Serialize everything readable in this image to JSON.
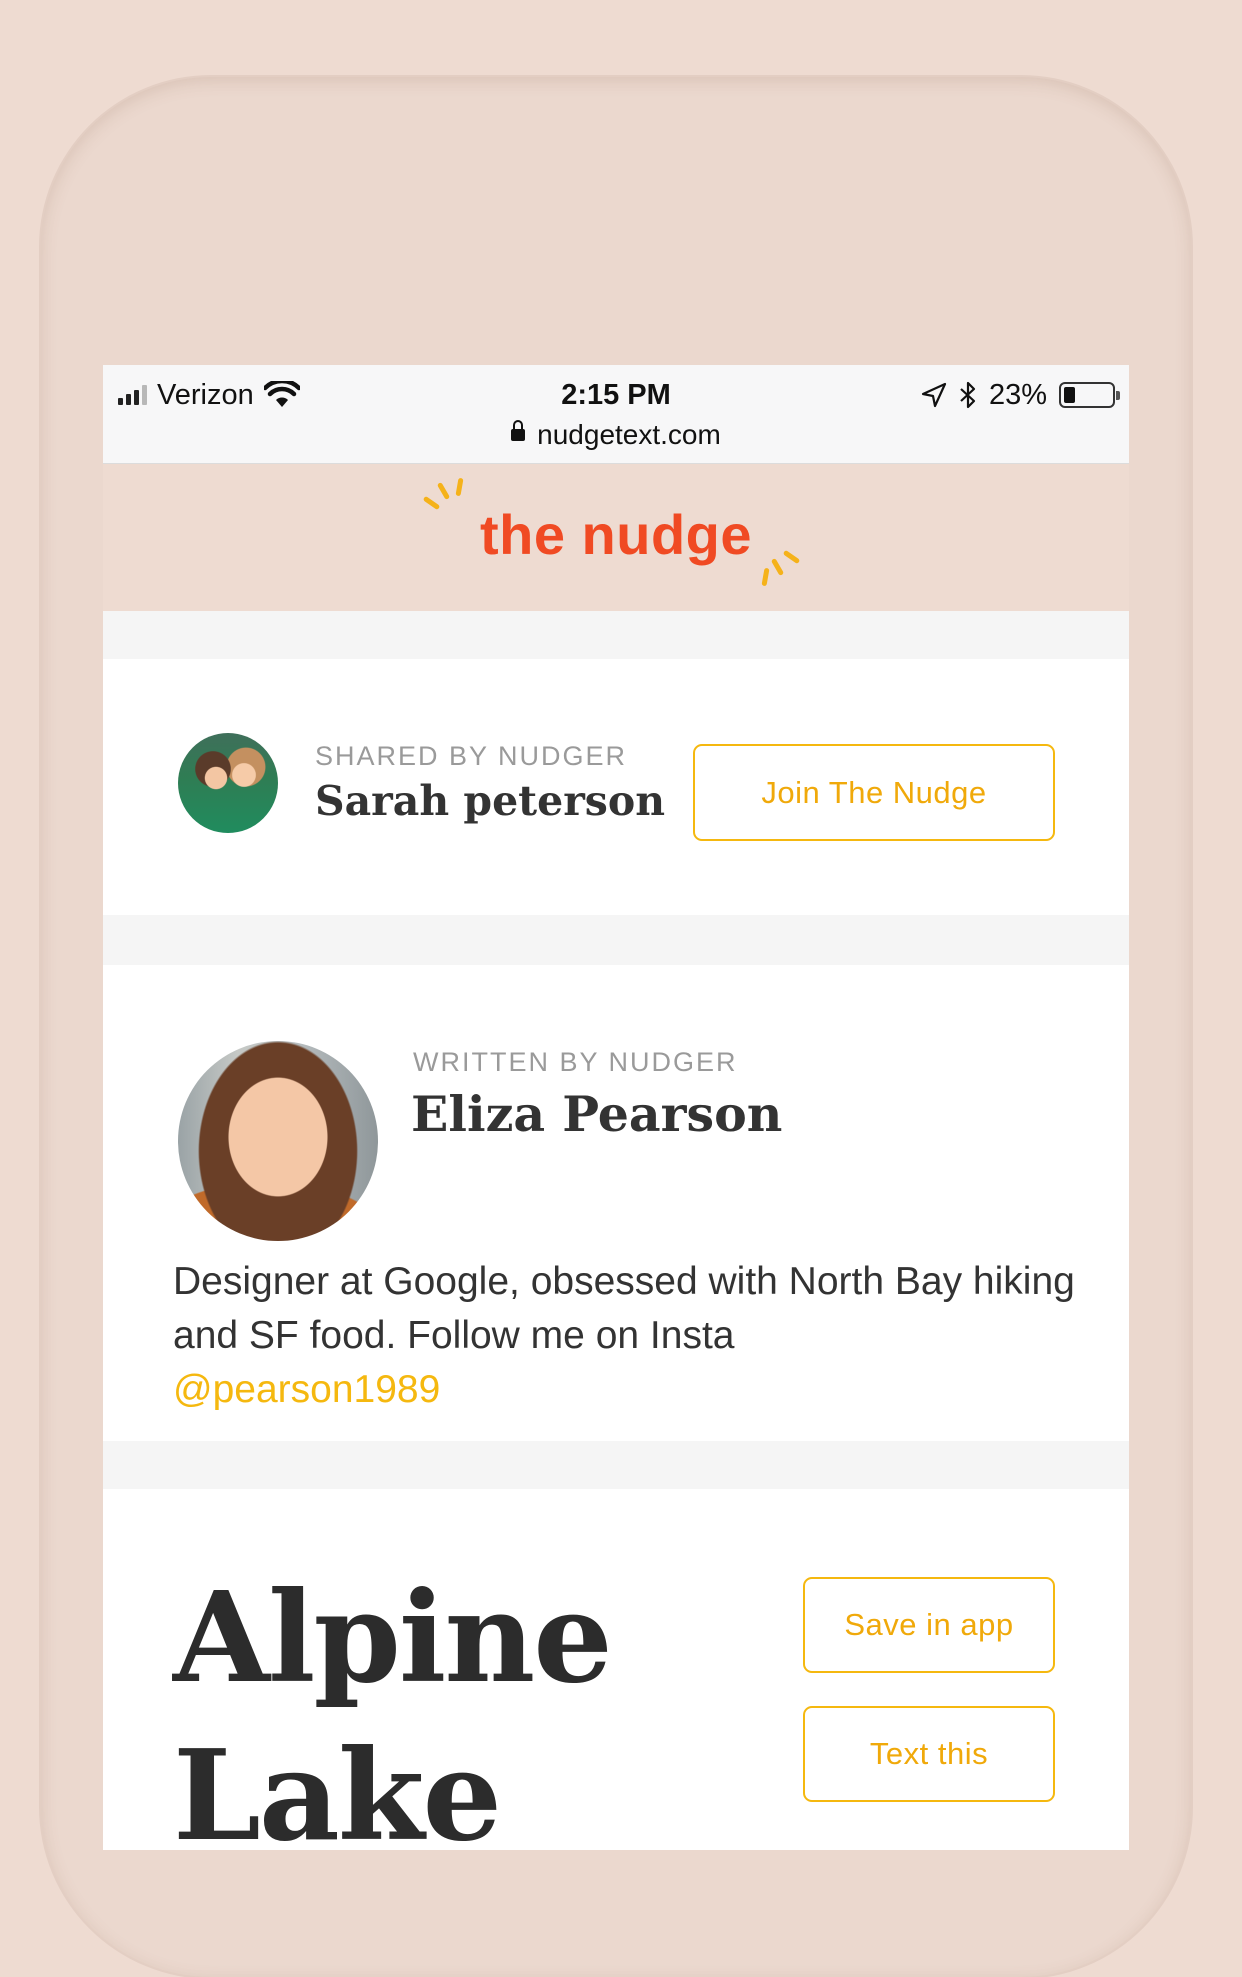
{
  "status_bar": {
    "carrier": "Verizon",
    "time": "2:15 PM",
    "url": "nudgetext.com",
    "battery": "23%",
    "battery_level": 0.23,
    "signal_bars": 3,
    "icons": [
      "signal-icon",
      "wifi-icon",
      "lock-icon",
      "location-arrow-icon",
      "bluetooth-icon",
      "battery-icon"
    ]
  },
  "header": {
    "logo": "the nudge"
  },
  "shared_card": {
    "kicker": "SHARED BY NUDGER",
    "name": "Sarah peterson",
    "join_button": "Join The Nudge"
  },
  "author_card": {
    "kicker": "WRITTEN BY NUDGER",
    "name": "Eliza Pearson",
    "bio": "Designer at Google, obsessed with North Bay hiking and SF food. Follow me on Insta",
    "handle": "@pearson1989"
  },
  "post_card": {
    "title_line1": "Alpine",
    "title_line2": "Lake",
    "save_button": "Save in app",
    "text_button": "Text this"
  },
  "colors": {
    "accent": "#f5b80f",
    "logo": "#f04a23",
    "background": "#eedbd1"
  }
}
